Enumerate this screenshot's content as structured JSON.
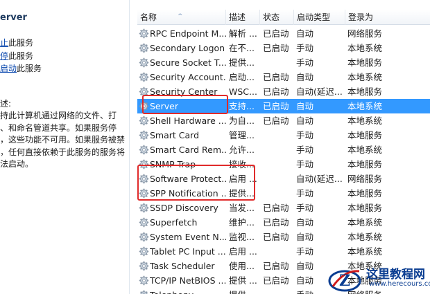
{
  "left_pane": {
    "title": "erver",
    "links": [
      {
        "link": "止",
        "suffix": "此服务"
      },
      {
        "link": "停",
        "suffix": "此服务"
      },
      {
        "link": "启动",
        "suffix": "此服务"
      }
    ],
    "desc_heading": "述:",
    "desc_lines": [
      "持此计算机通过网络的文件、打",
      "、和命名管道共享。如果服务停",
      "，这些功能不可用。如果服务被禁",
      "，任何直接依赖于此服务的服务将",
      "法启动。"
    ]
  },
  "list": {
    "headers": {
      "name": "名称",
      "desc": "描述",
      "status": "状态",
      "startup": "启动类型",
      "logon": "登录为"
    },
    "sort_arrow": "^",
    "rows": [
      {
        "name": "RPC Endpoint M...",
        "desc": "解析 ...",
        "status": "已启动",
        "startup": "自动",
        "logon": "网络服务"
      },
      {
        "name": "Secondary Logon",
        "desc": "在不...",
        "status": "已启动",
        "startup": "手动",
        "logon": "本地系统"
      },
      {
        "name": "Secure Socket T...",
        "desc": "提供...",
        "status": "",
        "startup": "手动",
        "logon": "本地服务"
      },
      {
        "name": "Security Account...",
        "desc": "启动...",
        "status": "已启动",
        "startup": "自动",
        "logon": "本地系统"
      },
      {
        "name": "Security Center",
        "desc": "WSC...",
        "status": "已启动",
        "startup": "自动(延迟...",
        "logon": "本地服务"
      },
      {
        "name": "Server",
        "desc": "支持...",
        "status": "已启动",
        "startup": "自动",
        "logon": "本地系统",
        "selected": true
      },
      {
        "name": "Shell Hardware ...",
        "desc": "为自...",
        "status": "已启动",
        "startup": "自动",
        "logon": "本地系统"
      },
      {
        "name": "Smart Card",
        "desc": "管理...",
        "status": "",
        "startup": "手动",
        "logon": "本地服务"
      },
      {
        "name": "Smart Card Rem...",
        "desc": "允许...",
        "status": "",
        "startup": "手动",
        "logon": "本地系统"
      },
      {
        "name": "SNMP Trap",
        "desc": "接收...",
        "status": "",
        "startup": "手动",
        "logon": "本地服务"
      },
      {
        "name": "Software Protect...",
        "desc": "启用 ...",
        "status": "",
        "startup": "自动(延迟...",
        "logon": "网络服务"
      },
      {
        "name": "SPP Notification ...",
        "desc": "提供...",
        "status": "",
        "startup": "手动",
        "logon": "本地服务"
      },
      {
        "name": "SSDP Discovery",
        "desc": "当发...",
        "status": "已启动",
        "startup": "手动",
        "logon": "本地服务"
      },
      {
        "name": "Superfetch",
        "desc": "维护...",
        "status": "已启动",
        "startup": "自动",
        "logon": "本地系统"
      },
      {
        "name": "System Event N...",
        "desc": "监视...",
        "status": "已启动",
        "startup": "自动",
        "logon": "本地系统"
      },
      {
        "name": "Tablet PC Input ...",
        "desc": "启用 ...",
        "status": "",
        "startup": "手动",
        "logon": "本地系统"
      },
      {
        "name": "Task Scheduler",
        "desc": "使用...",
        "status": "已启动",
        "startup": "自动",
        "logon": "本地系统"
      },
      {
        "name": "TCP/IP NetBIOS ...",
        "desc": "提供 ...",
        "status": "已启动",
        "startup": "自动",
        "logon": "本地服务"
      },
      {
        "name": "Telephony",
        "desc": "提供...",
        "status": "",
        "startup": "手动",
        "logon": "网络服务"
      }
    ]
  },
  "watermark": {
    "text": "这里教程网",
    "url": "www.herecours.com"
  },
  "colors": {
    "selection": "#3399ff",
    "highlight_box": "#e02a2a",
    "link": "#0645ad"
  }
}
